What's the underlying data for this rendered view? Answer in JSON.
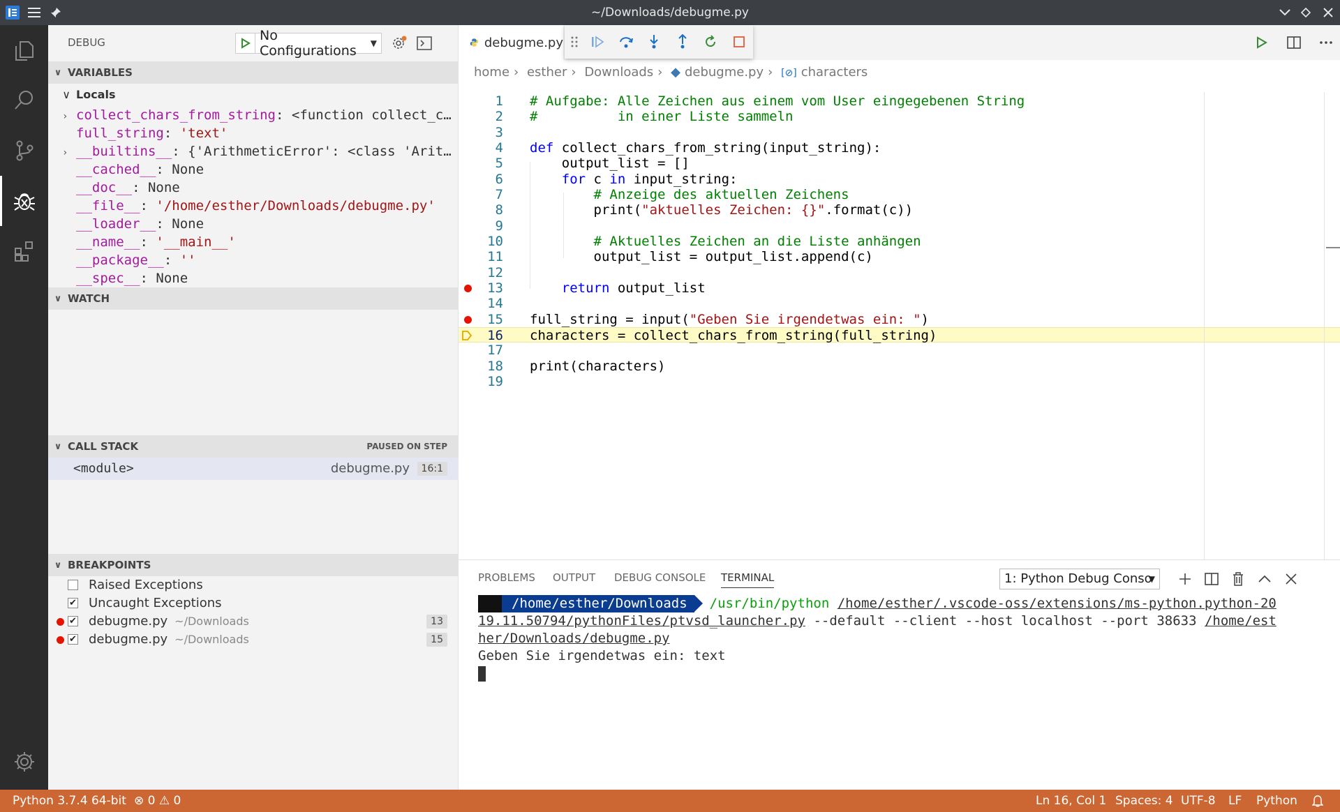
{
  "window": {
    "title": "~/Downloads/debugme.py"
  },
  "sidebar": {
    "title": "DEBUG",
    "config": "No Configurations",
    "variables": {
      "header": "VARIABLES",
      "scope": "Locals",
      "items": [
        {
          "name": "collect_chars_from_string",
          "value": "<function collect_c…",
          "kind": "plain",
          "expandable": true
        },
        {
          "name": "full_string",
          "value": "'text'",
          "kind": "str",
          "expandable": false
        },
        {
          "name": "__builtins__",
          "value": "{'ArithmeticError': <class 'Arit…",
          "kind": "plain",
          "expandable": true
        },
        {
          "name": "__cached__",
          "value": "None",
          "kind": "plain",
          "expandable": false
        },
        {
          "name": "__doc__",
          "value": "None",
          "kind": "plain",
          "expandable": false
        },
        {
          "name": "__file__",
          "value": "'/home/esther/Downloads/debugme.py'",
          "kind": "str",
          "expandable": false
        },
        {
          "name": "__loader__",
          "value": "None",
          "kind": "plain",
          "expandable": false
        },
        {
          "name": "__name__",
          "value": "'__main__'",
          "kind": "str",
          "expandable": false
        },
        {
          "name": "__package__",
          "value": "''",
          "kind": "str",
          "expandable": false
        },
        {
          "name": "__spec__",
          "value": "None",
          "kind": "plain",
          "expandable": false
        }
      ]
    },
    "watch": {
      "header": "WATCH"
    },
    "callstack": {
      "header": "CALL STACK",
      "state": "PAUSED ON STEP",
      "frames": [
        {
          "name": "<module>",
          "file": "debugme.py",
          "pos": "16:1"
        }
      ]
    },
    "breakpoints": {
      "header": "BREAKPOINTS",
      "items": [
        {
          "label": "Raised Exceptions",
          "checked": false
        },
        {
          "label": "Uncaught Exceptions",
          "checked": true
        },
        {
          "label": "debugme.py",
          "path": "~/Downloads",
          "line": "13",
          "checked": true,
          "dot": true
        },
        {
          "label": "debugme.py",
          "path": "~/Downloads",
          "line": "15",
          "checked": true,
          "dot": true
        }
      ]
    }
  },
  "editor": {
    "tab": "debugme.py",
    "breadcrumb": [
      "home",
      "esther",
      "Downloads",
      "debugme.py",
      "characters"
    ],
    "current_line": 16,
    "breakpoint_lines": [
      13,
      15
    ],
    "lines": [
      {
        "n": "1",
        "tokens": [
          {
            "t": "# Aufgabe: Alle Zeichen aus einem vom User eingegebenen String",
            "c": "comment"
          }
        ]
      },
      {
        "n": "2",
        "tokens": [
          {
            "t": "#          in einer Liste sammeln",
            "c": "comment"
          }
        ]
      },
      {
        "n": "3",
        "tokens": []
      },
      {
        "n": "4",
        "tokens": [
          {
            "t": "def",
            "c": "kw"
          },
          {
            "t": " collect_chars_from_string(input_string):",
            "c": "plain"
          }
        ]
      },
      {
        "n": "5",
        "tokens": [
          {
            "t": "    output_list = []",
            "c": "plain"
          }
        ]
      },
      {
        "n": "6",
        "tokens": [
          {
            "t": "    ",
            "c": "plain"
          },
          {
            "t": "for",
            "c": "kw"
          },
          {
            "t": " c ",
            "c": "plain"
          },
          {
            "t": "in",
            "c": "kw"
          },
          {
            "t": " input_string:",
            "c": "plain"
          }
        ]
      },
      {
        "n": "7",
        "tokens": [
          {
            "t": "        ",
            "c": "plain"
          },
          {
            "t": "# Anzeige des aktuellen Zeichens",
            "c": "comment"
          }
        ]
      },
      {
        "n": "8",
        "tokens": [
          {
            "t": "        print(",
            "c": "plain"
          },
          {
            "t": "\"aktuelles Zeichen: {}\"",
            "c": "str"
          },
          {
            "t": ".format(c))",
            "c": "plain"
          }
        ]
      },
      {
        "n": "9",
        "tokens": []
      },
      {
        "n": "10",
        "tokens": [
          {
            "t": "        ",
            "c": "plain"
          },
          {
            "t": "# Aktuelles Zeichen an die Liste anhängen",
            "c": "comment"
          }
        ]
      },
      {
        "n": "11",
        "tokens": [
          {
            "t": "        output_list = output_list.append(c)",
            "c": "plain"
          }
        ]
      },
      {
        "n": "12",
        "tokens": []
      },
      {
        "n": "13",
        "tokens": [
          {
            "t": "    ",
            "c": "plain"
          },
          {
            "t": "return",
            "c": "kw"
          },
          {
            "t": " output_list",
            "c": "plain"
          }
        ]
      },
      {
        "n": "14",
        "tokens": []
      },
      {
        "n": "15",
        "tokens": [
          {
            "t": "full_string = input(",
            "c": "plain"
          },
          {
            "t": "\"Geben Sie irgendetwas ein: \"",
            "c": "str"
          },
          {
            "t": ")",
            "c": "plain"
          }
        ]
      },
      {
        "n": "16",
        "tokens": [
          {
            "t": "characters = collect_chars_from_string(full_string)",
            "c": "plain"
          }
        ]
      },
      {
        "n": "17",
        "tokens": []
      },
      {
        "n": "18",
        "tokens": [
          {
            "t": "print(characters)",
            "c": "plain"
          }
        ]
      },
      {
        "n": "19",
        "tokens": []
      }
    ]
  },
  "panel": {
    "tabs": [
      "PROBLEMS",
      "OUTPUT",
      "DEBUG CONSOLE",
      "TERMINAL"
    ],
    "active_tab": "TERMINAL",
    "terminal_select": "1: Python Debug Conso",
    "terminal": {
      "prompt_dir": "/home/esther/Downloads",
      "cmd": "/usr/bin/python",
      "args1": "/home/esther/.vscode-oss/extensions/ms-python.python-20",
      "args2a": "19.11.50794/pythonFiles/ptvsd_launcher.py",
      "args2b": " --default --client --host localhost --port 38633 ",
      "args2c": "/home/est",
      "args3": "her/Downloads/debugme.py",
      "output": "Geben Sie irgendetwas ein: text"
    }
  },
  "statusbar": {
    "interpreter": "Python 3.7.4 64-bit",
    "errors": "0",
    "warnings": "0",
    "position": "Ln 16, Col 1",
    "spaces": "Spaces: 4",
    "encoding": "UTF-8",
    "eol": "LF",
    "language": "Python"
  },
  "colors": {
    "statusbar": "#cc6633",
    "breakpoint": "#e51400",
    "current_line": "#fffbc5"
  }
}
